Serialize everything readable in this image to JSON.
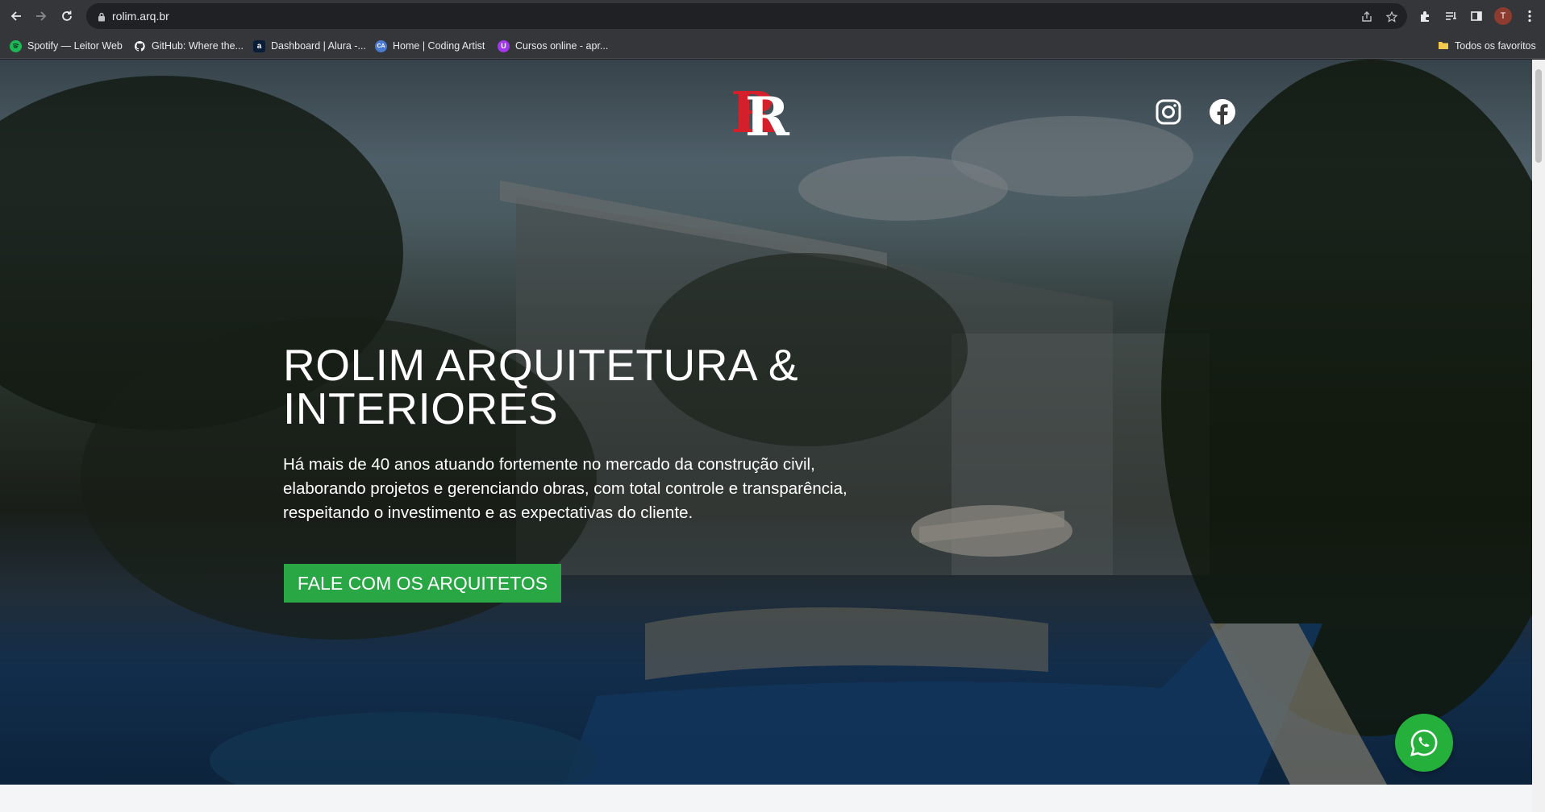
{
  "browser": {
    "url": "rolim.arq.br",
    "avatar_letter": "T",
    "bookmarks": [
      {
        "label": "Spotify — Leitor Web",
        "icon": "spotify-icon",
        "color": "#1db954"
      },
      {
        "label": "GitHub: Where the...",
        "icon": "github-icon",
        "color": "#ffffff"
      },
      {
        "label": "Dashboard | Alura -...",
        "icon": "alura-icon",
        "color": "#0a1d37"
      },
      {
        "label": "Home | Coding Artist",
        "icon": "coding-artist-icon",
        "color": "#4a7bd0"
      },
      {
        "label": "Cursos online - apr...",
        "icon": "udemy-icon",
        "color": "#a435f0"
      }
    ],
    "all_bookmarks": "Todos os favoritos"
  },
  "hero": {
    "logo_letters": "RR",
    "title": "ROLIM ARQUITETURA & INTERIORES",
    "subtitle": "Há mais de 40 anos atuando fortemente no mercado da construção civil, elaborando projetos e gerenciando obras, com total controle e transparência, respeitando o investimento e as expectativas do cliente.",
    "cta_label": "FALE COM OS ARQUITETOS"
  },
  "colors": {
    "cta": "#29a745",
    "whatsapp": "#25b03c",
    "logo_red": "#d4202a"
  }
}
